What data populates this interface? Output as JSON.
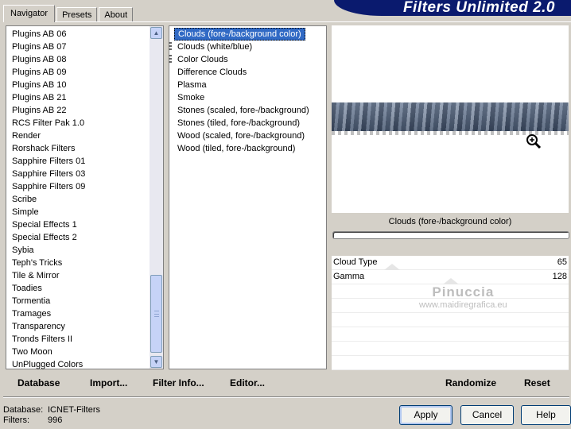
{
  "tabs": [
    {
      "label": "Navigator",
      "active": true
    },
    {
      "label": "Presets",
      "active": false
    },
    {
      "label": "About",
      "active": false
    }
  ],
  "banner_title": "Filters Unlimited 2.0",
  "categories": [
    "Plugins AB 06",
    "Plugins AB 07",
    "Plugins AB 08",
    "Plugins AB 09",
    "Plugins AB 10",
    "Plugins AB 21",
    "Plugins AB 22",
    "RCS Filter Pak 1.0",
    "Render",
    "Rorshack Filters",
    "Sapphire Filters 01",
    "Sapphire Filters 03",
    "Sapphire Filters 09",
    "Scribe",
    "Simple",
    "Special Effects 1",
    "Special Effects 2",
    "Sybia",
    "Teph's Tricks",
    "Tile & Mirror",
    "Toadies",
    "Tormentia",
    "Tramages",
    "Transparency",
    "Tronds Filters II",
    "Two Moon",
    "UnPlugged Colors"
  ],
  "selected_category": "Render",
  "filters": [
    {
      "label": "Clouds (fore-/background color)",
      "selected": true,
      "marked": false
    },
    {
      "label": "Clouds (white/blue)",
      "selected": false,
      "marked": true
    },
    {
      "label": "Color Clouds",
      "selected": false,
      "marked": true
    },
    {
      "label": "Difference Clouds",
      "selected": false,
      "marked": false
    },
    {
      "label": "Plasma",
      "selected": false,
      "marked": false
    },
    {
      "label": "Smoke",
      "selected": false,
      "marked": false
    },
    {
      "label": "Stones (scaled, fore-/background)",
      "selected": false,
      "marked": false
    },
    {
      "label": "Stones (tiled, fore-/background)",
      "selected": false,
      "marked": false
    },
    {
      "label": "Wood (scaled, fore-/background)",
      "selected": false,
      "marked": false
    },
    {
      "label": "Wood (tiled, fore-/background)",
      "selected": false,
      "marked": false
    }
  ],
  "preview": {
    "filter_name": "Clouds (fore-/background color)",
    "zoom_icon": "zoom-in-icon"
  },
  "params": [
    {
      "label": "Cloud Type",
      "value": "65"
    },
    {
      "label": "Gamma",
      "value": "128"
    }
  ],
  "watermark": {
    "line1": "Pinuccia",
    "line2": "www.maidiregrafica.eu"
  },
  "left_links": {
    "database": "Database",
    "import": "Import...",
    "filter_info": "Filter Info...",
    "editor": "Editor..."
  },
  "right_links": {
    "randomize": "Randomize",
    "reset": "Reset"
  },
  "status": {
    "database_label": "Database:",
    "database_value": "ICNET-Filters",
    "filters_label": "Filters:",
    "filters_value": "996"
  },
  "buttons": {
    "apply": "Apply",
    "cancel": "Cancel",
    "help": "Help"
  },
  "colors": {
    "banner": "#0a1a6e",
    "selection": "#316ac5",
    "window": "#d4d0c8"
  }
}
